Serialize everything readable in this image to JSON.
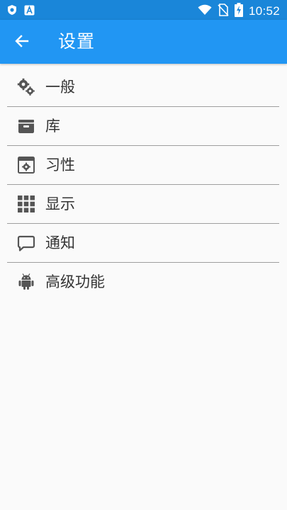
{
  "status_bar": {
    "time": "10:52",
    "left_icons": [
      "shield-icon",
      "a-app-icon"
    ],
    "right_icons": [
      "wifi-icon",
      "no-sim-icon",
      "battery-charging-icon"
    ]
  },
  "app_bar": {
    "title": "设置",
    "back_icon": "arrow-left-icon"
  },
  "menu": {
    "items": [
      {
        "label": "一般",
        "icon": "gears-icon"
      },
      {
        "label": "库",
        "icon": "archive-icon"
      },
      {
        "label": "习性",
        "icon": "settings-window-icon"
      },
      {
        "label": "显示",
        "icon": "grid-icon"
      },
      {
        "label": "通知",
        "icon": "message-icon"
      },
      {
        "label": "高级功能",
        "icon": "android-icon"
      }
    ]
  },
  "colors": {
    "status_bar": "#1a86d9",
    "app_bar": "#2196f3",
    "background": "#fafafa",
    "text": "#333333",
    "icon": "#555555",
    "divider": "#9e9e9e"
  }
}
